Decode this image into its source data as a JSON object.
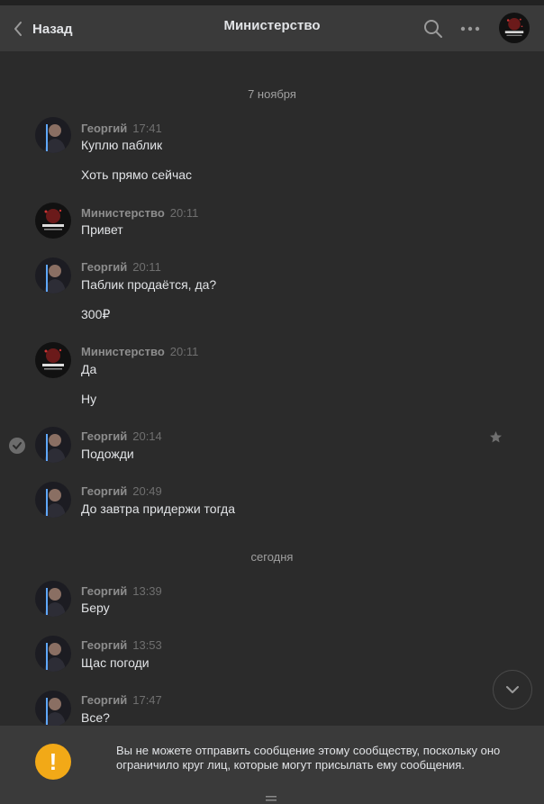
{
  "header": {
    "back_label": "Назад",
    "title": "Министерство"
  },
  "colors": {
    "header_bg": "#3a3a3a",
    "feed_bg": "#2b2b2b",
    "author": "#8d8d8d",
    "text": "#e1e3e6",
    "warning": "#f2a917"
  },
  "feed": {
    "dates": [
      "7 ноября",
      "сегодня"
    ],
    "messages": [
      {
        "author": "Георгий",
        "time": "17:41",
        "lines": [
          "Куплю паблик",
          "Хоть прямо сейчас"
        ],
        "avatar": "georgiy-avatar"
      },
      {
        "author": "Министерство",
        "time": "20:11",
        "lines": [
          "Привет"
        ],
        "avatar": "ministry-avatar"
      },
      {
        "author": "Георгий",
        "time": "20:11",
        "lines": [
          "Паблик продаётся, да?",
          "300₽"
        ],
        "avatar": "georgiy-avatar"
      },
      {
        "author": "Министерство",
        "time": "20:11",
        "lines": [
          "Да",
          "Ну"
        ],
        "avatar": "ministry-avatar"
      },
      {
        "author": "Георгий",
        "time": "20:14",
        "lines": [
          "Подожди"
        ],
        "avatar": "georgiy-avatar",
        "selected": true
      },
      {
        "author": "Георгий",
        "time": "20:49",
        "lines": [
          "До завтра придержи тогда"
        ],
        "avatar": "georgiy-avatar"
      },
      {
        "author": "Георгий",
        "time": "13:39",
        "lines": [
          "Беру"
        ],
        "avatar": "georgiy-avatar"
      },
      {
        "author": "Георгий",
        "time": "13:53",
        "lines": [
          "Щас погоди"
        ],
        "avatar": "georgiy-avatar"
      },
      {
        "author": "Георгий",
        "time": "17:47",
        "lines": [
          "Все?"
        ],
        "avatar": "georgiy-avatar"
      }
    ]
  },
  "footer": {
    "warning_icon": "!",
    "notice": "Вы не можете отправить сообщение этому сообществу, поскольку оно ограничило круг лиц, которые могут присылать ему сообщения."
  }
}
